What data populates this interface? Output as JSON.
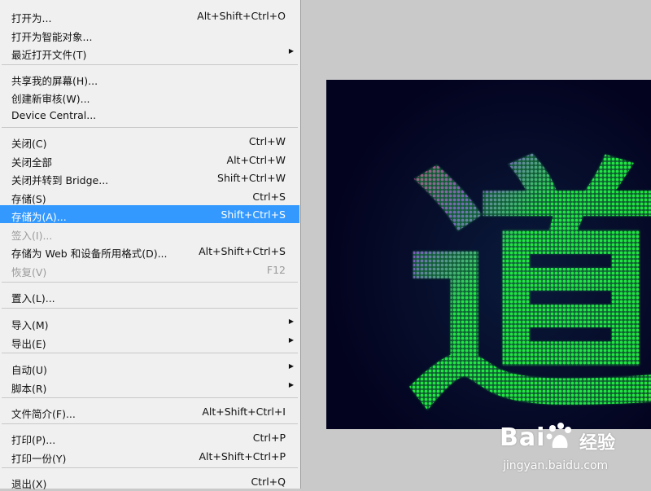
{
  "menu": {
    "items": [
      {
        "label": "打开为...",
        "shortcut": "Alt+Shift+Ctrl+O"
      },
      {
        "label": "打开为智能对象...",
        "shortcut": ""
      },
      {
        "label": "最近打开文件(T)",
        "shortcut": "",
        "submenu": true
      },
      {
        "label": "共享我的屏幕(H)...",
        "shortcut": ""
      },
      {
        "label": "创建新审核(W)...",
        "shortcut": ""
      },
      {
        "label": "Device Central...",
        "shortcut": ""
      },
      {
        "label": "关闭(C)",
        "shortcut": "Ctrl+W"
      },
      {
        "label": "关闭全部",
        "shortcut": "Alt+Ctrl+W"
      },
      {
        "label": "关闭并转到 Bridge...",
        "shortcut": "Shift+Ctrl+W"
      },
      {
        "label": "存储(S)",
        "shortcut": "Ctrl+S"
      },
      {
        "label": "存储为(A)...",
        "shortcut": "Shift+Ctrl+S",
        "highlighted": true
      },
      {
        "label": "签入(I)...",
        "shortcut": "",
        "disabled": true
      },
      {
        "label": "存储为 Web 和设备所用格式(D)...",
        "shortcut": "Alt+Shift+Ctrl+S"
      },
      {
        "label": "恢复(V)",
        "shortcut": "F12",
        "disabled": true
      },
      {
        "label": "置入(L)...",
        "shortcut": ""
      },
      {
        "label": "导入(M)",
        "shortcut": "",
        "submenu": true
      },
      {
        "label": "导出(E)",
        "shortcut": "",
        "submenu": true
      },
      {
        "label": "自动(U)",
        "shortcut": "",
        "submenu": true
      },
      {
        "label": "脚本(R)",
        "shortcut": "",
        "submenu": true
      },
      {
        "label": "文件简介(F)...",
        "shortcut": "Alt+Shift+Ctrl+I"
      },
      {
        "label": "打印(P)...",
        "shortcut": "Ctrl+P"
      },
      {
        "label": "打印一份(Y)",
        "shortcut": "Alt+Shift+Ctrl+P"
      },
      {
        "label": "退出(X)",
        "shortcut": "Ctrl+Q"
      }
    ]
  },
  "canvas": {
    "glyph": "道",
    "background": "#03031f",
    "glyph_color": "#22ee44",
    "accent_colors": [
      "#ff2266",
      "#aa22ff",
      "#ffee33"
    ]
  },
  "watermark": {
    "logo": "Bai",
    "logo_suffix": "经验",
    "url": "jingyan.baidu.com"
  }
}
